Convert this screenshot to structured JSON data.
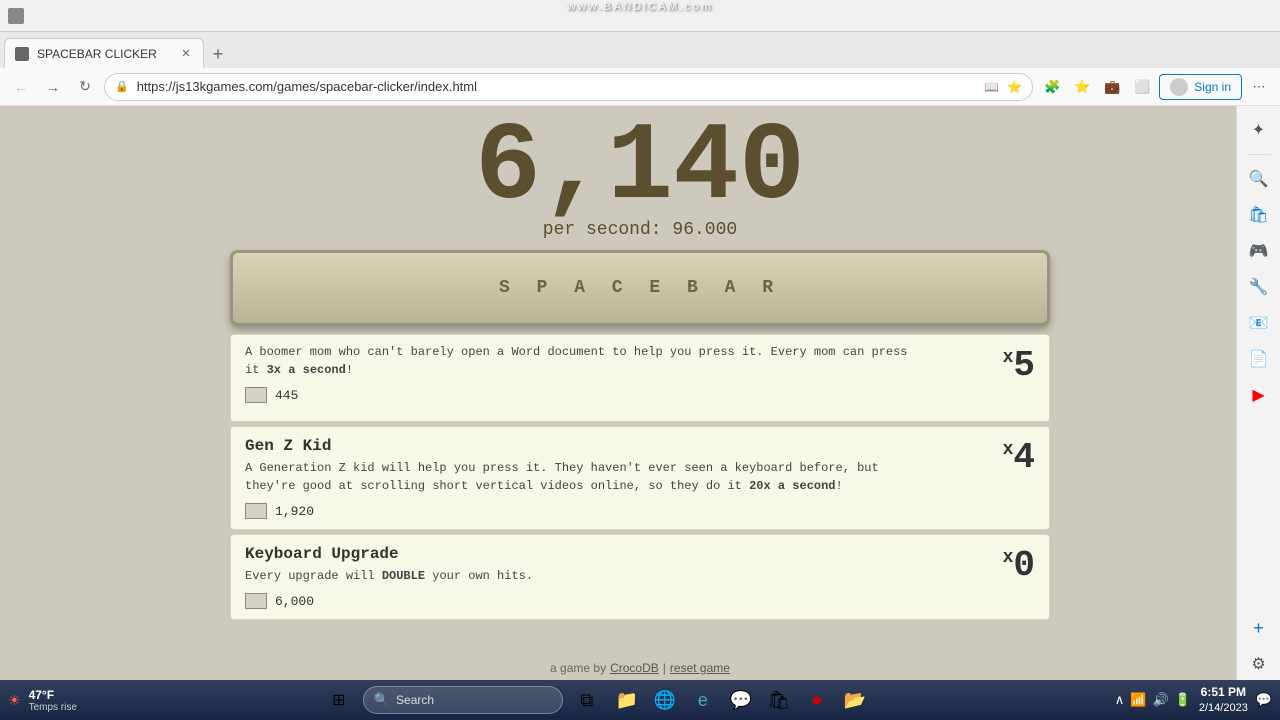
{
  "browser": {
    "tab_title": "SPACEBAR CLICKER",
    "url": "https://js13kgames.com/games/spacebar-clicker/index.html",
    "sign_in_label": "Sign in"
  },
  "bandicam": {
    "watermark": "www.BANDICAM.com"
  },
  "game": {
    "score": "6,140",
    "per_second_label": "per second:",
    "per_second_value": "96.000",
    "spacebar_label": "S P A C E B A R"
  },
  "partial_card": {
    "desc_line1": "A boomer mom who can't barely open a Word document to help you press it. Every mom can press",
    "desc_line2": "it 3x a second!",
    "cost": "445",
    "count": "5",
    "count_prefix": "x"
  },
  "gen_z_card": {
    "title": "Gen Z Kid",
    "desc_line1": "A Generation Z kid will help you press it. They haven't ever seen a keyboard before, but",
    "desc_line2": "they're good at scrolling short vertical videos online, so they do it 20x a second!",
    "cost": "1,920",
    "count": "4",
    "count_prefix": "x",
    "bold_per_second": "20x a second"
  },
  "keyboard_card": {
    "title": "Keyboard Upgrade",
    "desc": "Every upgrade will DOUBLE your own hits.",
    "cost": "6,000",
    "count": "0",
    "count_prefix": "x",
    "bold_double": "DOUBLE"
  },
  "taskbar": {
    "weather_temp": "47°F",
    "weather_desc": "Temps rise",
    "search_placeholder": "Search",
    "time": "6:51 PM",
    "date": "2/14/2023"
  }
}
